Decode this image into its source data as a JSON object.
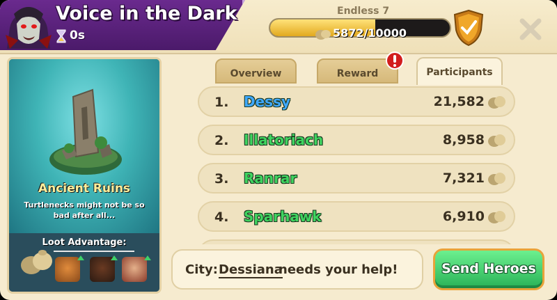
{
  "event": {
    "title": "Voice in the Dark",
    "timer": "0s",
    "tier": "Endless 7",
    "progress_current": "5872",
    "progress_max": "/10000",
    "progress_fraction": 0.587
  },
  "tabs": [
    {
      "label": "Overview",
      "active": false
    },
    {
      "label": "Reward",
      "active": false,
      "alert": true
    },
    {
      "label": "Participants",
      "active": true
    }
  ],
  "participants": [
    {
      "rank": "1.",
      "name": "Dessy",
      "score": "21,582",
      "color": "#3fa8ff"
    },
    {
      "rank": "2.",
      "name": "Illatoriach",
      "score": "8,958",
      "color": "#3fd35f"
    },
    {
      "rank": "3.",
      "name": "Ranrar",
      "score": "7,321",
      "color": "#3fd35f"
    },
    {
      "rank": "4.",
      "name": "Sparhawk",
      "score": "6,910",
      "color": "#3fd35f"
    }
  ],
  "location": {
    "name": "Ancient Ruins",
    "description": "Turtlenecks might not be so bad after all...",
    "loot_label": "Loot Advantage:"
  },
  "city": {
    "label": "City:",
    "name": "Dessiana",
    "text": "needs your help!"
  },
  "actions": {
    "send_heroes": "Send Heroes"
  },
  "icons": {
    "avatar": "vampire-avatar",
    "timer": "hourglass-icon",
    "resource": "coin-sack-icon",
    "tier_badge": "shield-check-icon",
    "close": "close-icon",
    "alert": "exclamation-alert-icon"
  }
}
